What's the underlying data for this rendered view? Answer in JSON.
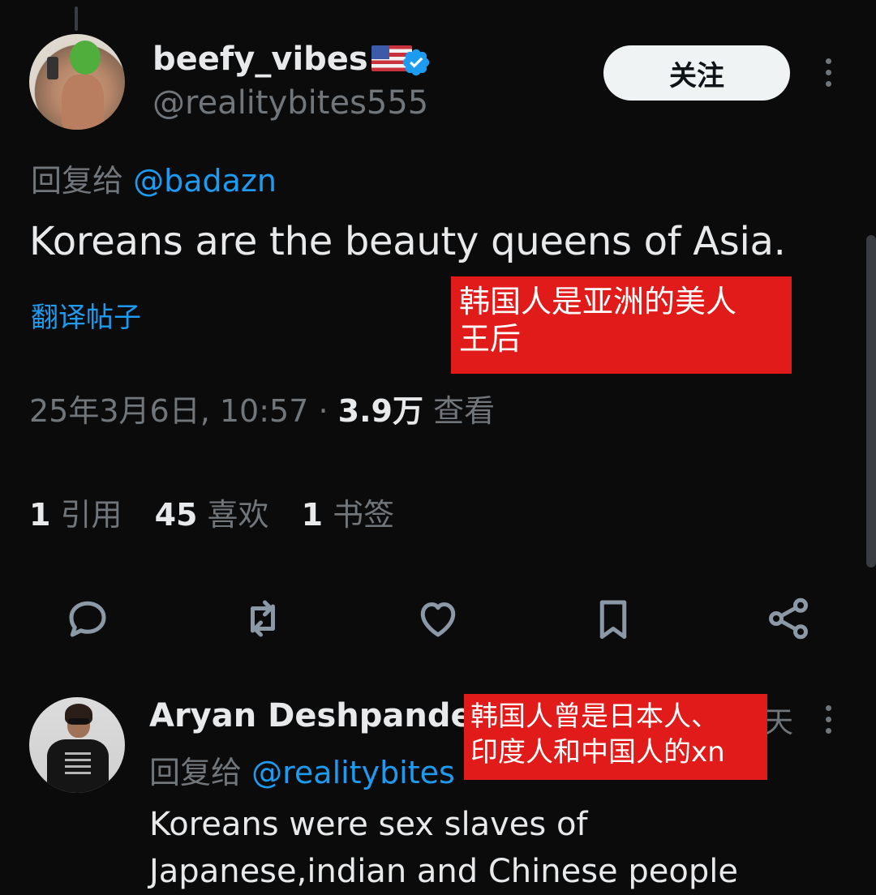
{
  "tweet": {
    "author": {
      "display_name": "beefy_vibes",
      "flag": "🇺🇸",
      "handle": "@realitybites555",
      "verified": true
    },
    "follow_label": "关注",
    "reply_prefix": "回复给",
    "reply_mention": "@badazn",
    "text": "Koreans are the beauty queens of Asia.",
    "translate_label": "翻译帖子",
    "timestamp": "25年3月6日, 10:57 ·",
    "views_count": "3.9万",
    "views_label": "查看",
    "stats": {
      "quotes_count": "1",
      "quotes_label": "引用",
      "likes_count": "45",
      "likes_label": "喜欢",
      "bookmarks_count": "1",
      "bookmarks_label": "书签"
    },
    "actions": [
      "reply-icon",
      "retweet-icon",
      "like-icon",
      "bookmark-icon",
      "share-icon"
    ]
  },
  "overlay1": {
    "line1": "韩国人是亚洲的美人",
    "line2": "王后"
  },
  "reply": {
    "display_name": "Aryan Deshpande",
    "time": "天",
    "reply_prefix": "回复给",
    "reply_mention": "@realitybites",
    "line1": "Koreans were sex slaves of",
    "line2": "Japanese,indian and Chinese people"
  },
  "overlay2": {
    "line1": "韩国人曾是日本人、",
    "line2": "印度人和中国人的xn"
  },
  "colors": {
    "background": "#0b0b0c",
    "accent": "#1d9bf0",
    "muted": "#71767b",
    "overlay": "#e11a1a"
  }
}
